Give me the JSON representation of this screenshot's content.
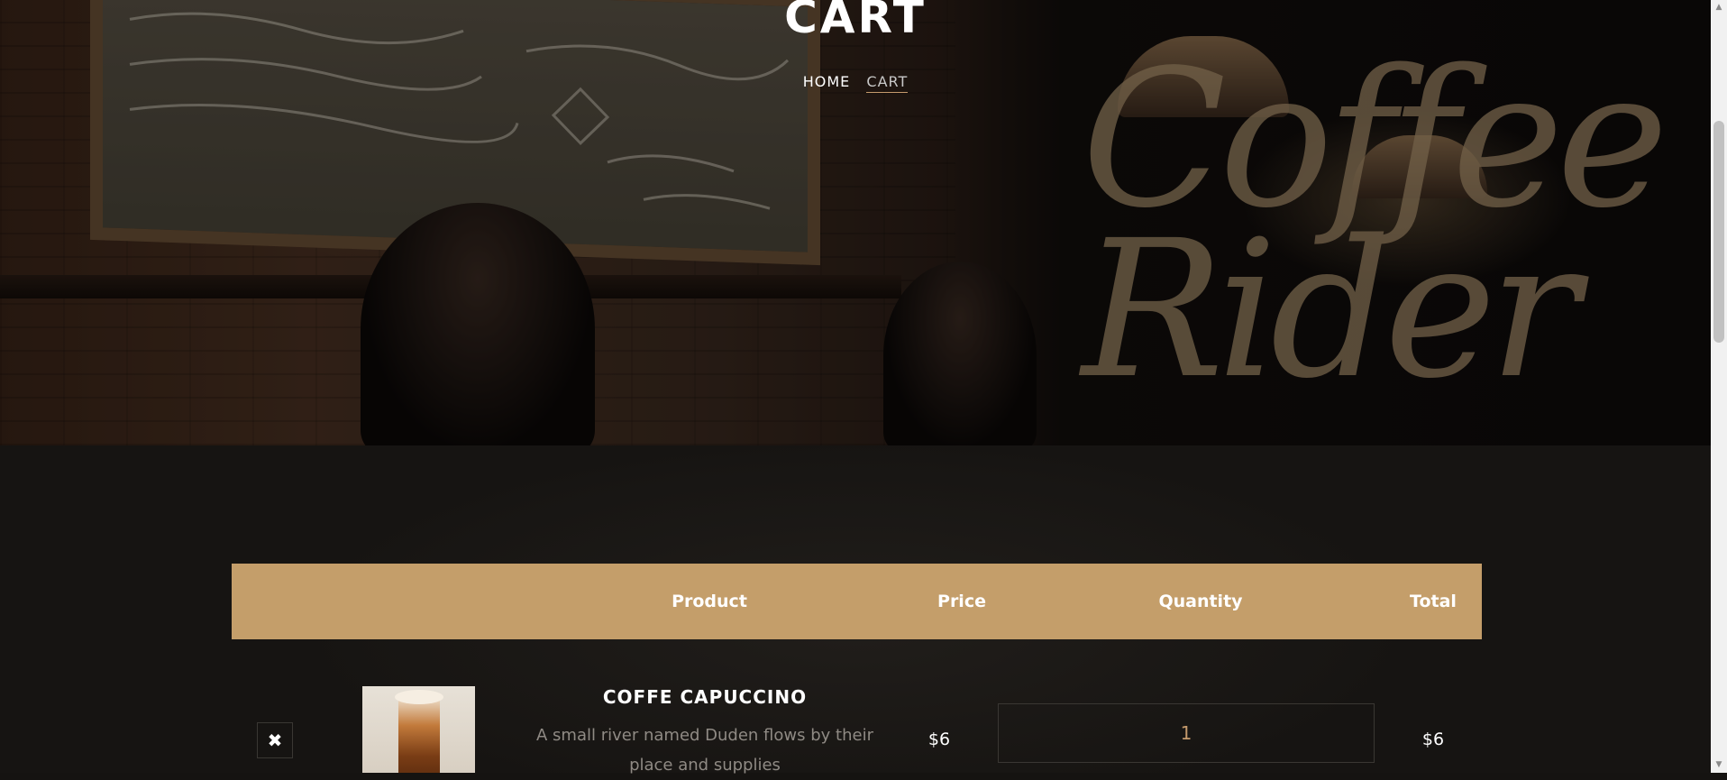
{
  "hero": {
    "title": "CART",
    "breadcrumb": {
      "home": "HOME",
      "current": "CART"
    },
    "background_sign_text": "Coffee Rider"
  },
  "cart": {
    "headers": {
      "remove": "",
      "image": "",
      "product": "Product",
      "price": "Price",
      "quantity": "Quantity",
      "total": "Total"
    },
    "items": [
      {
        "remove_icon": "✖",
        "name": "COFFE CAPUCCINO",
        "description": "A small river named Duden flows by their place and supplies",
        "price": "$6",
        "quantity": "1",
        "total": "$6"
      }
    ]
  },
  "colors": {
    "accent": "#c49e6a",
    "background": "#161412",
    "muted_text": "#8f8a84"
  },
  "scrollbar": {
    "up_icon": "▲",
    "down_icon": "▼"
  }
}
